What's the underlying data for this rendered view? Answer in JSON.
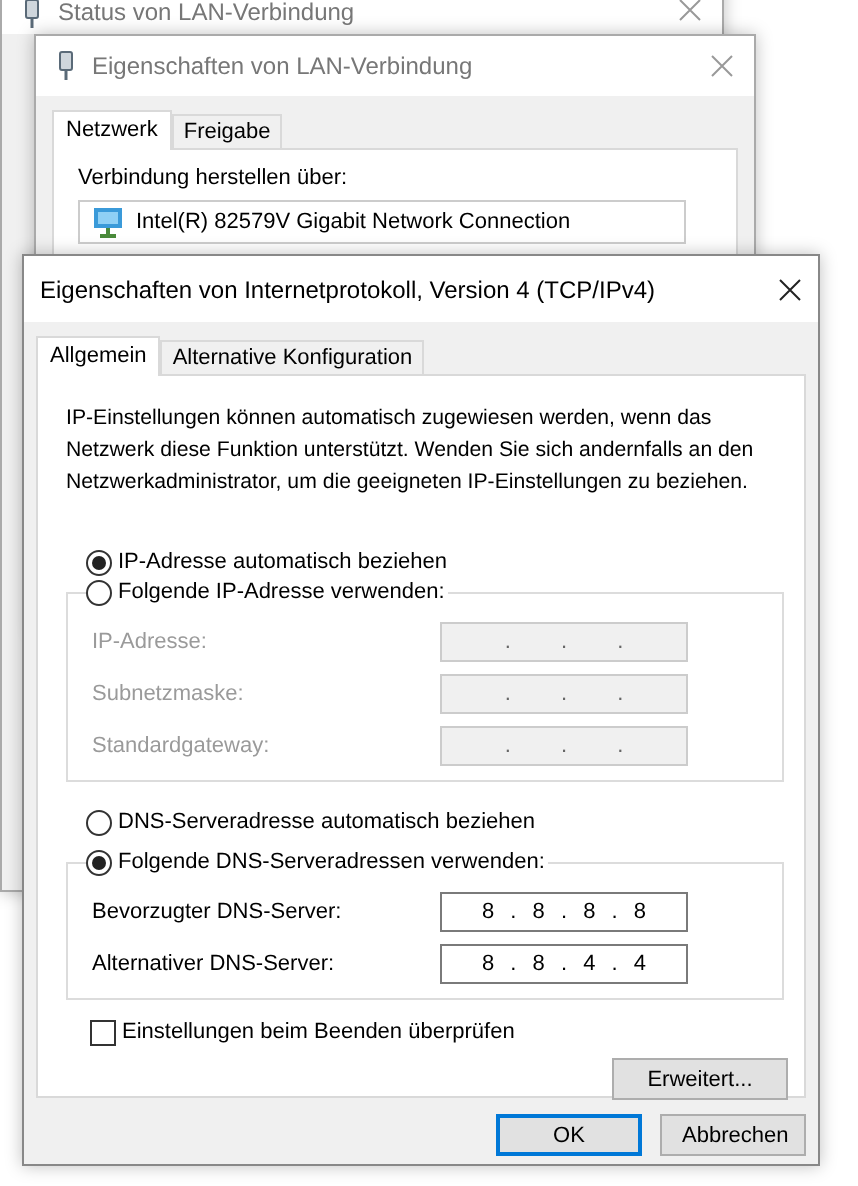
{
  "back_windows": [
    {
      "title": "Status von LAN-Verbindung"
    },
    {
      "title": "Eigenschaften von LAN-Verbindung",
      "tabs": [
        {
          "label": "Netzwerk",
          "selected": true
        },
        {
          "label": "Freigabe",
          "selected": false
        }
      ],
      "connect_label": "Verbindung herstellen über:",
      "adapter": "Intel(R) 82579V Gigabit Network Connection"
    }
  ],
  "dialog": {
    "title": "Eigenschaften von Internetprotokoll, Version 4 (TCP/IPv4)",
    "tabs": [
      {
        "label": "Allgemein",
        "selected": true
      },
      {
        "label": "Alternative Konfiguration",
        "selected": false
      }
    ],
    "description": "IP-Einstellungen können automatisch zugewiesen werden, wenn das\nNetzwerk diese Funktion unterstützt. Wenden Sie sich andernfalls an den\nNetzwerkadministrator, um die geeigneten IP-Einstellungen zu beziehen.",
    "ip_auto": {
      "label": "IP-Adresse automatisch beziehen",
      "selected": true
    },
    "ip_manual": {
      "label": "Folgende IP-Adresse verwenden:",
      "selected": false,
      "fields": [
        {
          "label": "IP-Adresse:",
          "value": ". . .",
          "disabled": true
        },
        {
          "label": "Subnetzmaske:",
          "value": ". . .",
          "disabled": true
        },
        {
          "label": "Standardgateway:",
          "value": ". . .",
          "disabled": true
        }
      ]
    },
    "dns_auto": {
      "label": "DNS-Serveradresse automatisch beziehen",
      "selected": false
    },
    "dns_manual": {
      "label": "Folgende DNS-Serveradressen verwenden:",
      "selected": true,
      "fields": [
        {
          "label": "Bevorzugter DNS-Server:",
          "value": "8 . 8 . 8 . 8",
          "disabled": false
        },
        {
          "label": "Alternativer DNS-Server:",
          "value": "8 . 8 . 4 . 4",
          "disabled": false
        }
      ]
    },
    "validate": {
      "label": "Einstellungen beim Beenden überprüfen",
      "checked": false
    },
    "advanced_button": "Erweitert...",
    "buttons": [
      {
        "label": "OK",
        "default": true
      },
      {
        "label": "Abbrechen",
        "default": false
      }
    ]
  }
}
